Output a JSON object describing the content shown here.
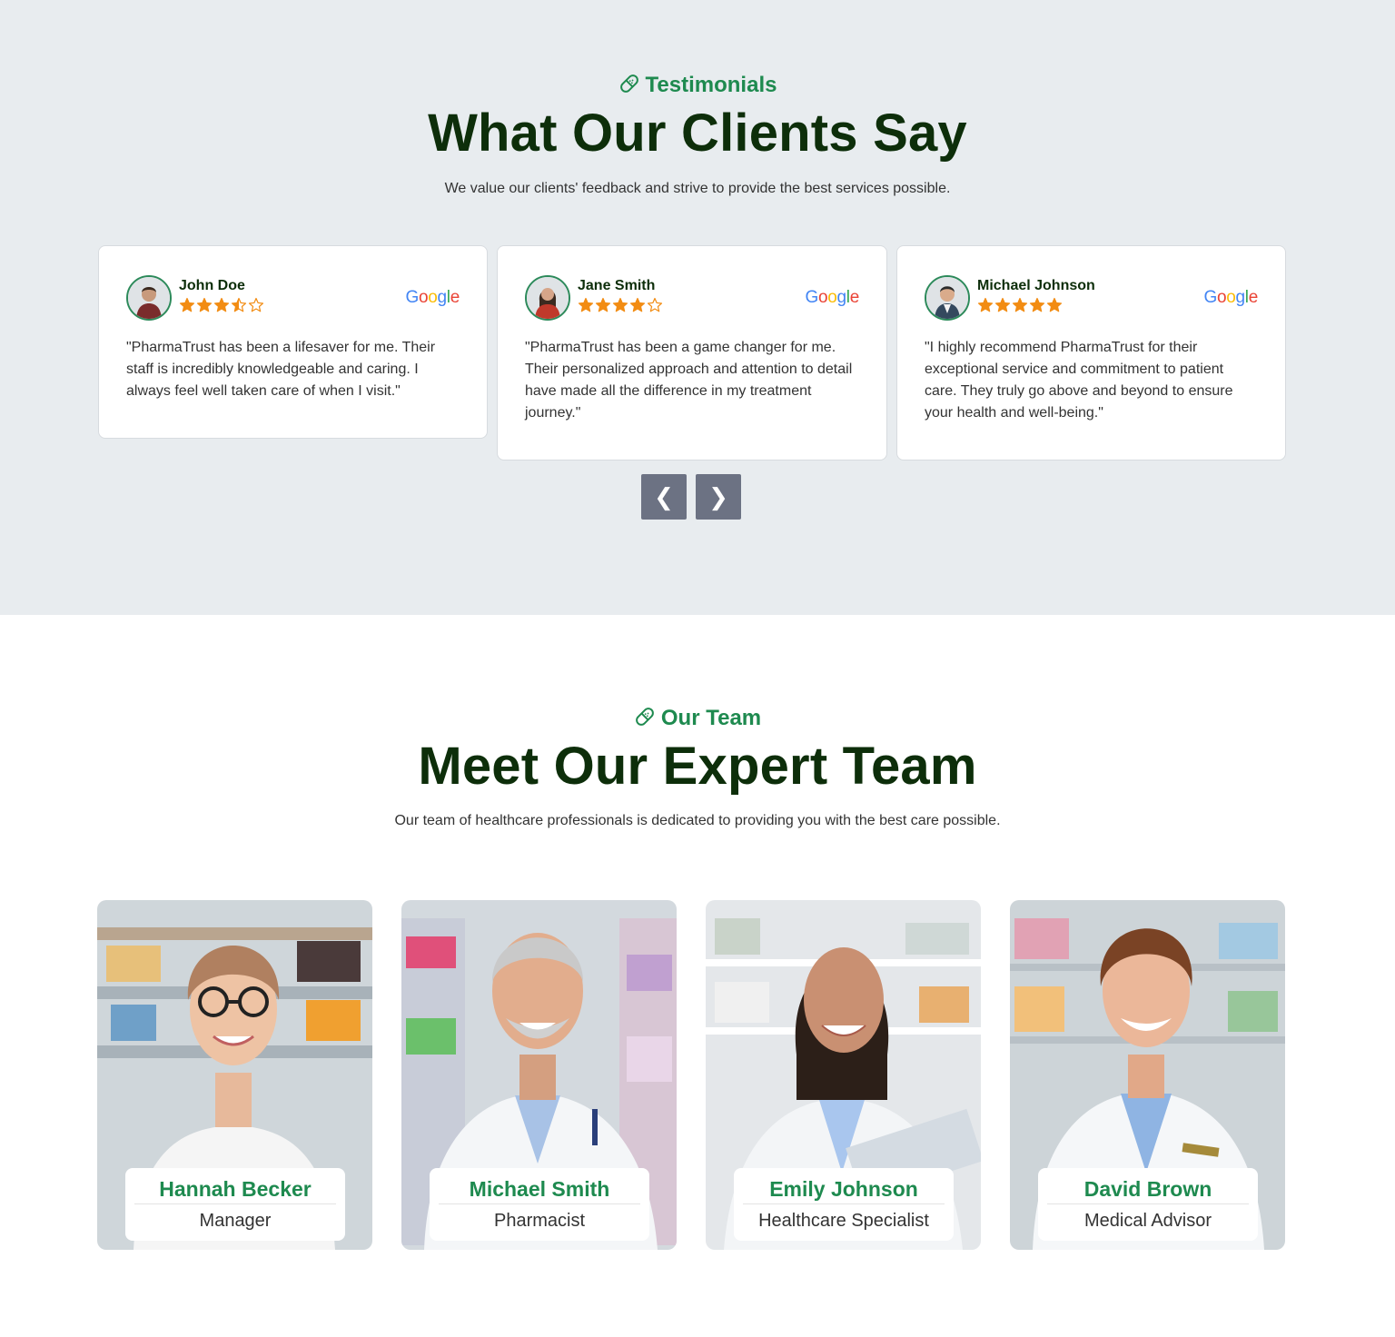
{
  "testimonials": {
    "eyebrow": "Testimonials",
    "heading": "What Our Clients Say",
    "subtitle": "We value our clients' feedback and strive to provide the best services possible.",
    "cards": [
      {
        "name": "John Doe",
        "rating": 3.5,
        "source": "Google",
        "text": "\"PharmaTrust has been a lifesaver for me. Their staff is incredibly knowledgeable and caring. I always feel well taken care of when I visit.\""
      },
      {
        "name": "Jane Smith",
        "rating": 4,
        "source": "Google",
        "text": "\"PharmaTrust has been a game changer for me. Their personalized approach and attention to detail have made all the difference in my treatment journey.\""
      },
      {
        "name": "Michael Johnson",
        "rating": 5,
        "source": "Google",
        "text": "\"I highly recommend PharmaTrust for their exceptional service and commitment to patient care. They truly go above and beyond to ensure your health and well-being.\""
      }
    ],
    "prev_label": "❮",
    "next_label": "❯"
  },
  "team": {
    "eyebrow": "Our Team",
    "heading": "Meet Our Expert Team",
    "subtitle": "Our team of healthcare professionals is dedicated to providing you with the best care possible.",
    "members": [
      {
        "name": "Hannah Becker",
        "role": "Manager"
      },
      {
        "name": "Michael Smith",
        "role": "Pharmacist"
      },
      {
        "name": "Emily Johnson",
        "role": "Healthcare Specialist"
      },
      {
        "name": "David Brown",
        "role": "Medical Advisor"
      }
    ]
  },
  "colors": {
    "accent_green": "#1e8a4f",
    "heading_dark_green": "#0d2e0a",
    "star_orange": "#f28c13",
    "section_gray": "#e8ecef",
    "nav_button": "#6c7283"
  },
  "icons": {
    "eyebrow_icon": "bandage-pill-icon",
    "rating_icon": "star-icon",
    "review_source_icon": "google-logo"
  }
}
